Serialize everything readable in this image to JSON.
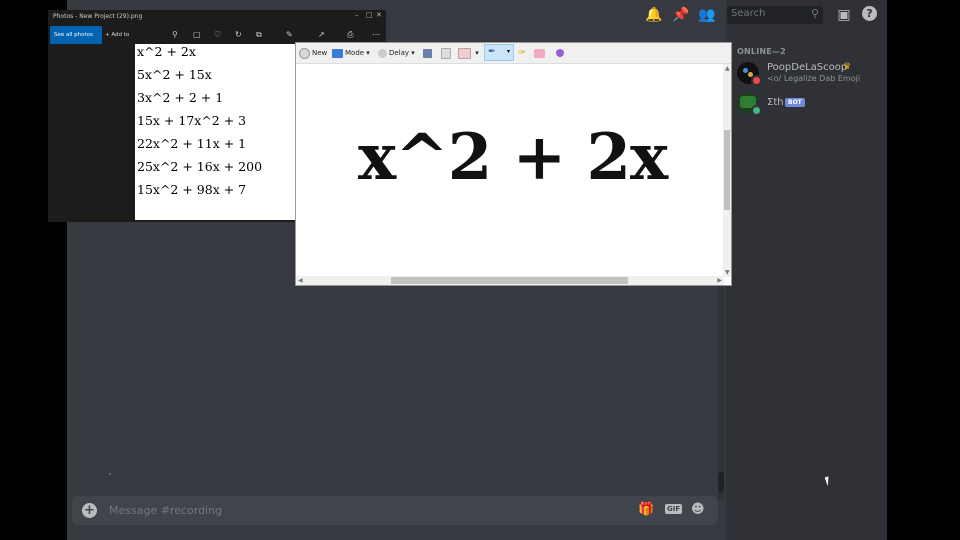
{
  "photos_window": {
    "title": "Photos - New Project (29).png",
    "see_all": "See all photos",
    "add_to": "Add to",
    "equations": [
      "x^2 + 2x",
      "5x^2 + 15x",
      "3x^2 + 2 + 1",
      "15x + 17x^2 + 3",
      "22x^2 + 11x + 1",
      "25x^2 + 16x + 200",
      "15x^2 + 98x + 7"
    ]
  },
  "snipping_tool": {
    "new_label": "New",
    "mode_label": "Mode",
    "delay_label": "Delay",
    "captured_text": "x^2 + 2x"
  },
  "discord": {
    "search_placeholder": "Search",
    "members_header": "ONLINE—2",
    "members": [
      {
        "name": "PoopDeLaScoop",
        "status_text": "<o/ Legalize Dab Emoji",
        "name_color": "#b9bbbe"
      },
      {
        "name": "Σth",
        "badge": "BOT",
        "name_color": "#b9bbbe"
      }
    ],
    "message_placeholder": "Message #recording",
    "gif_label": "GIF",
    "colors": {
      "background": "#36393f",
      "sidebar": "#2f3136",
      "accent": "#7289da",
      "input": "#40444b"
    }
  }
}
